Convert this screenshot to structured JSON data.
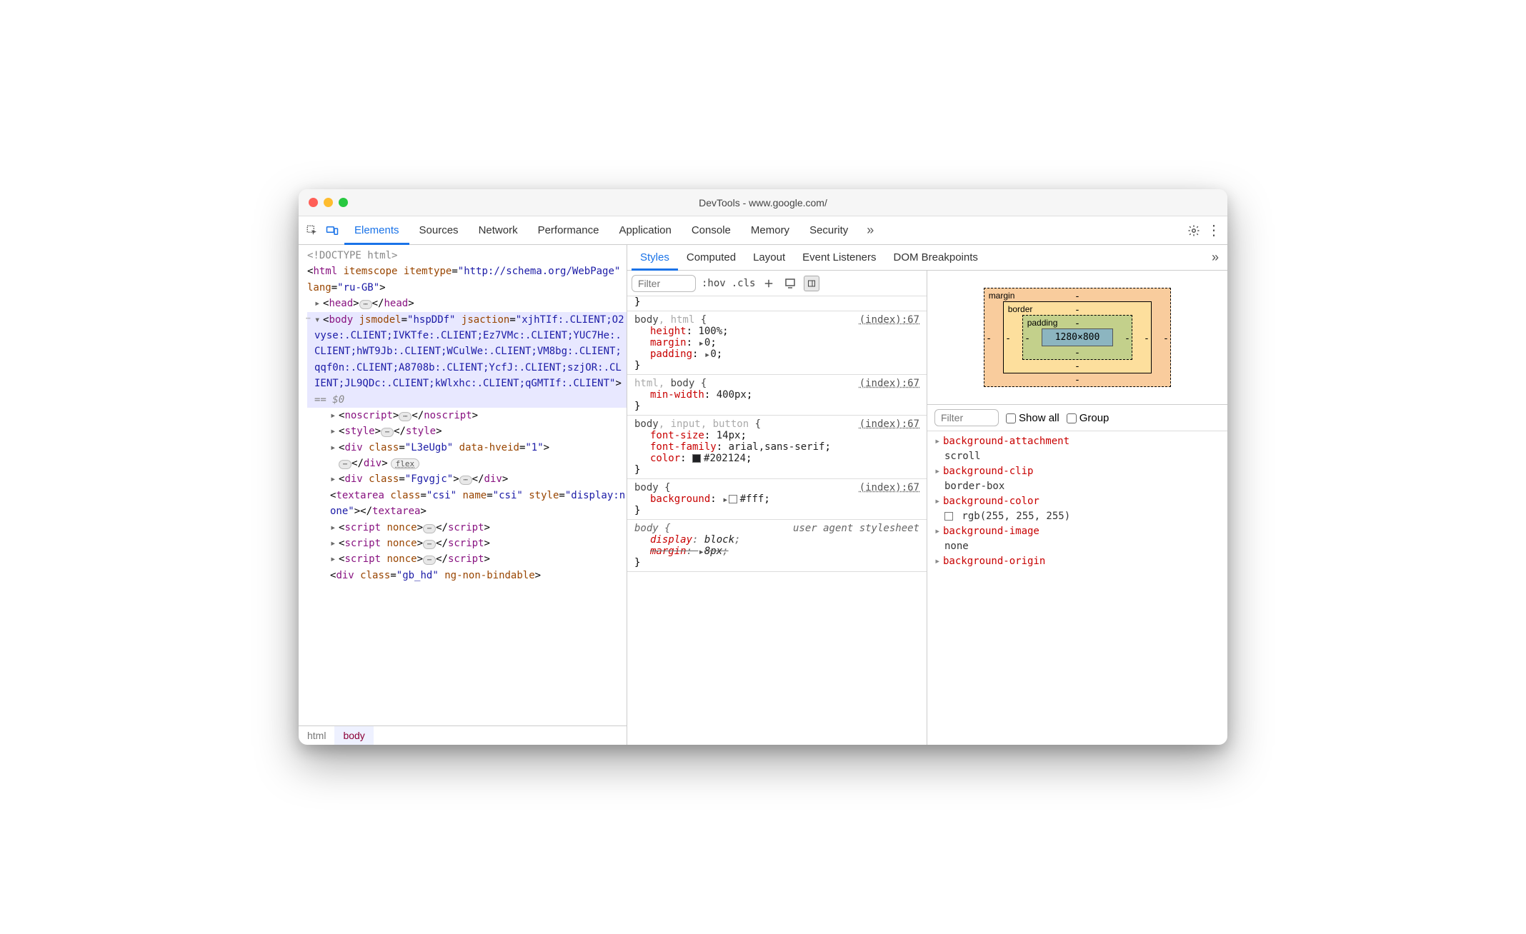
{
  "window_title": "DevTools - www.google.com/",
  "main_tabs": [
    "Elements",
    "Sources",
    "Network",
    "Performance",
    "Application",
    "Console",
    "Memory",
    "Security"
  ],
  "main_tab_active": "Elements",
  "sub_tabs": [
    "Styles",
    "Computed",
    "Layout",
    "Event Listeners",
    "DOM Breakpoints"
  ],
  "sub_tab_active": "Styles",
  "dom": {
    "doctype": "<!DOCTYPE html>",
    "html_open": {
      "tag": "html",
      "attrs": "itemscope itemtype=\"http://schema.org/WebPage\" lang=\"ru-GB\""
    },
    "head": {
      "open": "<head>",
      "close": "</head>"
    },
    "body_open": {
      "tag": "body",
      "attrs": "jsmodel=\"hspDDf\" jsaction=\"xjhTIf:.CLIENT;O2vyse:.CLIENT;IVKTfe:.CLIENT;Ez7VMc:.CLIENT;YUC7He:.CLIENT;hWT9Jb:.CLIENT;WCulWe:.CLIENT;VM8bg:.CLIENT;qqf0n:.CLIENT;A8708b:.CLIENT;YcfJ:.CLIENT;szjOR:.CLIENT;JL9QDc:.CLIENT;kWlxhc:.CLIENT;qGMTIf:.CLIENT\""
    },
    "body_marker": "== $0",
    "children": [
      {
        "raw_open": "<noscript>",
        "raw_close": "</noscript>",
        "ell": true,
        "tri": true
      },
      {
        "raw_open": "<style>",
        "raw_close": "</style>",
        "ell": true,
        "tri": true
      },
      {
        "tag": "div",
        "attrs": "class=\"L3eUgb\" data-hveid=\"1\"",
        "close": "</div>",
        "pill": "flex",
        "tri": true
      },
      {
        "tag": "div",
        "attrs": "class=\"Fgvgjc\"",
        "ell": true,
        "close_inline": "</div>",
        "tri": true
      },
      {
        "tag": "textarea",
        "attrs": "class=\"csi\" name=\"csi\" style=\"display:none\"",
        "close_inline": "</textarea>"
      },
      {
        "raw_open": "<script nonce>",
        "raw_close": "</script>",
        "ell": true,
        "tri": true
      },
      {
        "raw_open": "<script nonce>",
        "raw_close": "</script>",
        "ell": true,
        "tri": true
      },
      {
        "raw_open": "<script nonce>",
        "raw_close": "</script>",
        "ell": true,
        "tri": true
      },
      {
        "tag": "div",
        "attrs": "class=\"gb_hd\" ng-non-bindable"
      }
    ]
  },
  "breadcrumbs": [
    "html",
    "body"
  ],
  "styles_filter_placeholder": "Filter",
  "styles_toolbar": {
    "hov": ":hov",
    "cls": ".cls"
  },
  "rules": [
    {
      "selector_html": [
        {
          "t": "body",
          "dim": false
        },
        {
          "t": ", html",
          "dim": true
        }
      ],
      "source": "(index):67",
      "props": [
        {
          "n": "height",
          "v": "100%"
        },
        {
          "n": "margin",
          "v": "0",
          "tri": true
        },
        {
          "n": "padding",
          "v": "0",
          "tri": true
        }
      ]
    },
    {
      "selector_html": [
        {
          "t": "html, ",
          "dim": true
        },
        {
          "t": "body",
          "dim": false
        }
      ],
      "source": "(index):67",
      "props": [
        {
          "n": "min-width",
          "v": "400px"
        }
      ]
    },
    {
      "selector_html": [
        {
          "t": "body",
          "dim": false
        },
        {
          "t": ", input, button",
          "dim": true
        }
      ],
      "source": "(index):67",
      "props": [
        {
          "n": "font-size",
          "v": "14px"
        },
        {
          "n": "font-family",
          "v": "arial,sans-serif"
        },
        {
          "n": "color",
          "v": "#202124",
          "swatch": "swblack"
        }
      ]
    },
    {
      "selector_html": [
        {
          "t": "body",
          "dim": false
        }
      ],
      "source": "(index):67",
      "props": [
        {
          "n": "background",
          "v": "#fff",
          "tri": true,
          "swatch": "swffff"
        }
      ]
    },
    {
      "selector_html": [
        {
          "t": "body",
          "dim": false
        }
      ],
      "ua": true,
      "source": "user agent stylesheet",
      "props": [
        {
          "n": "display",
          "v": "block"
        },
        {
          "n": "margin",
          "v": "8px",
          "tri": true,
          "strike": true
        }
      ]
    }
  ],
  "boxmodel": {
    "labels": {
      "margin": "margin",
      "border": "border",
      "padding": "padding"
    },
    "content": "1280×800",
    "dash": "-"
  },
  "computed_filter_placeholder": "Filter",
  "computed_toggles": {
    "show_all": "Show all",
    "group": "Group"
  },
  "computed": [
    {
      "n": "background-attachment",
      "v": "scroll"
    },
    {
      "n": "background-clip",
      "v": "border-box"
    },
    {
      "n": "background-color",
      "v": "rgb(255, 255, 255)",
      "swatch": true
    },
    {
      "n": "background-image",
      "v": "none"
    },
    {
      "n": "background-origin",
      "v": ""
    }
  ]
}
